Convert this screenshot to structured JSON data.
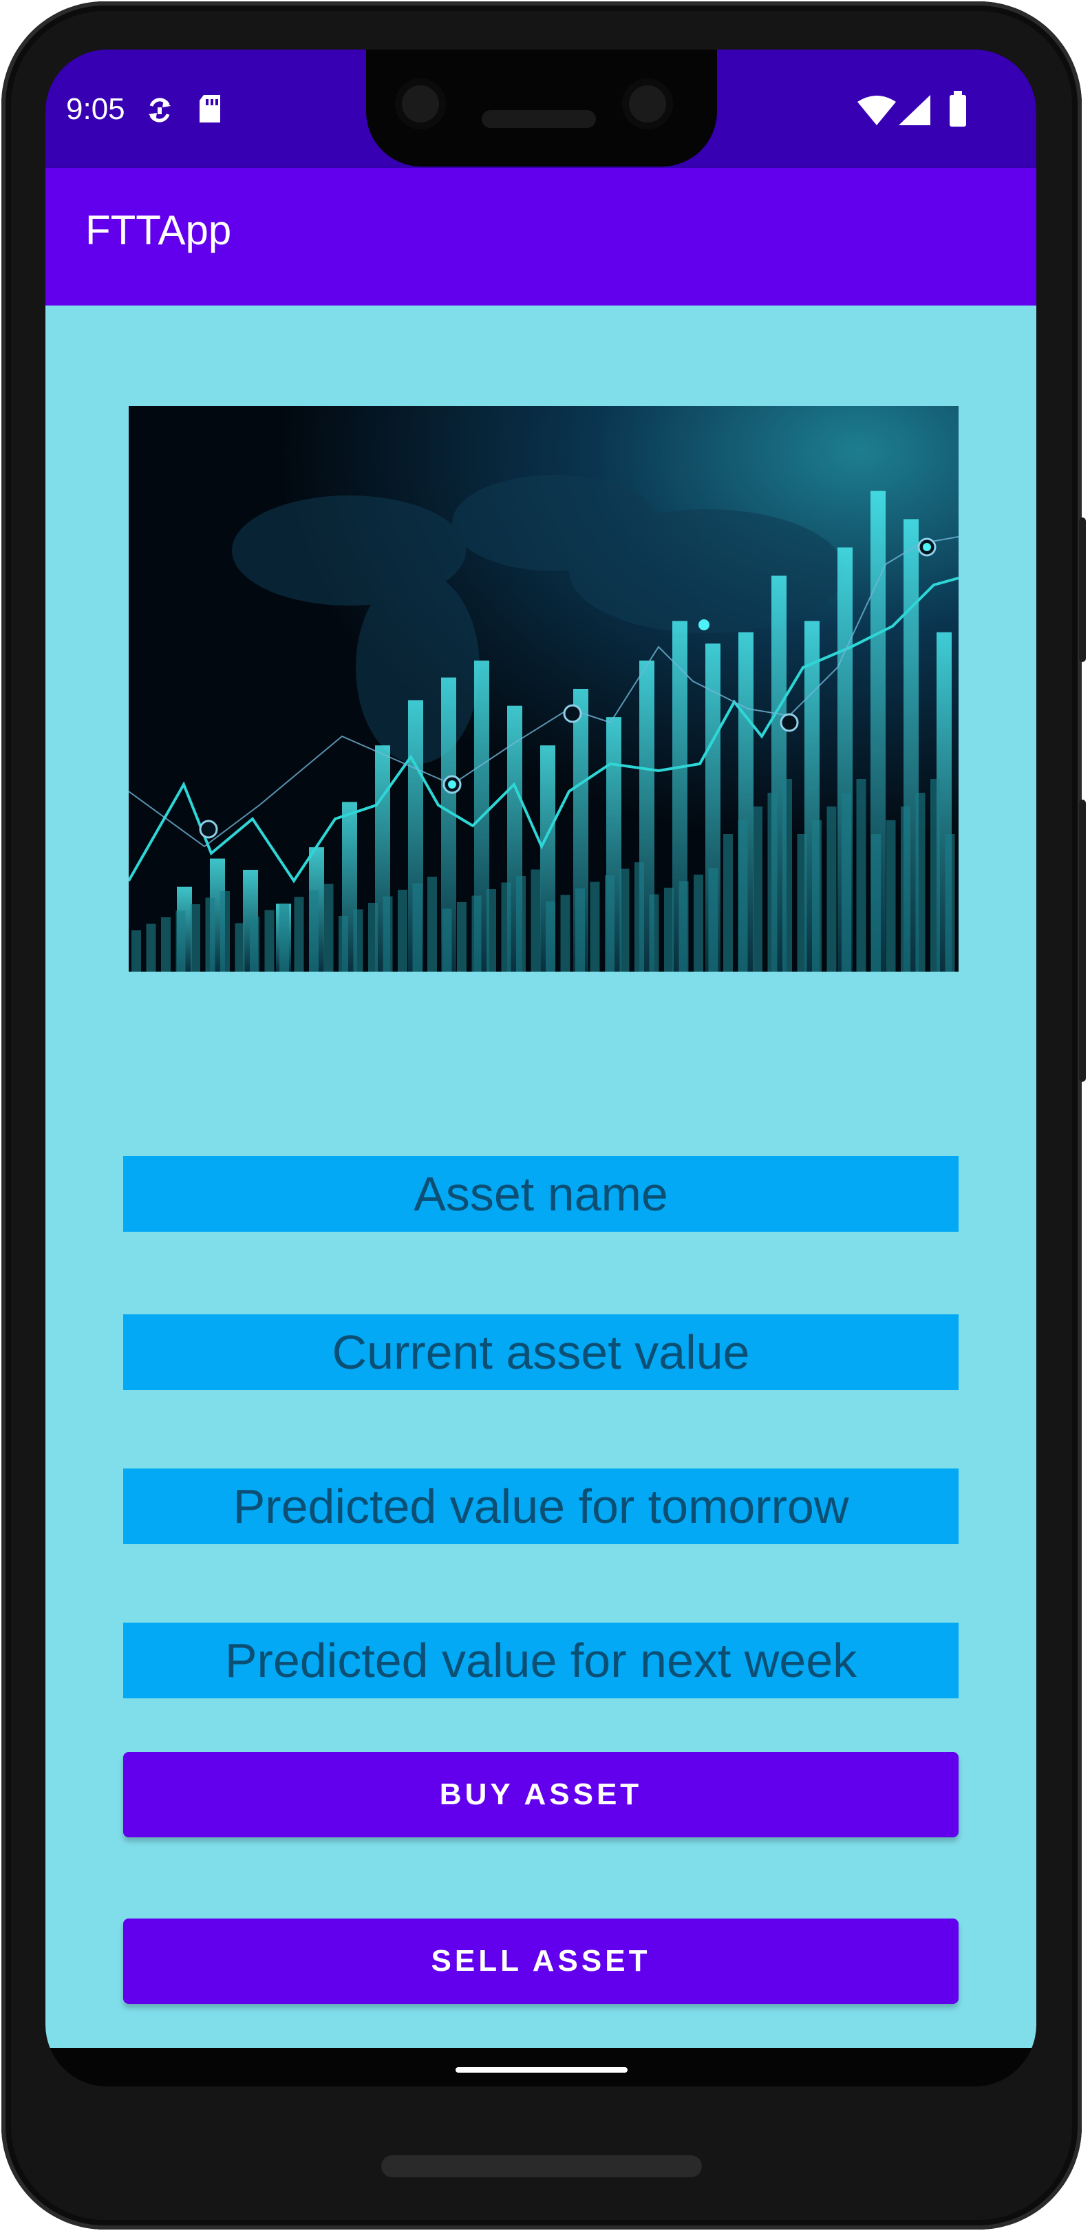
{
  "status_bar": {
    "time": "9:05",
    "icons": [
      "sync-icon",
      "sd-card-icon",
      "wifi-icon",
      "signal-icon",
      "battery-icon"
    ]
  },
  "app_bar": {
    "title": "FTTApp"
  },
  "fields": {
    "asset_name": "Asset name",
    "current_value": "Current asset value",
    "predicted_tomorrow": "Predicted value for tomorrow",
    "predicted_next_week": "Predicted value for next week"
  },
  "buttons": {
    "buy": "BUY ASSET",
    "sell": "SELL ASSET"
  },
  "colors": {
    "status_bar": "#3700b3",
    "app_bar": "#6200ee",
    "background": "#80deea",
    "field": "#03a9f4",
    "field_text": "#0b4f75",
    "button": "#6200ee"
  }
}
